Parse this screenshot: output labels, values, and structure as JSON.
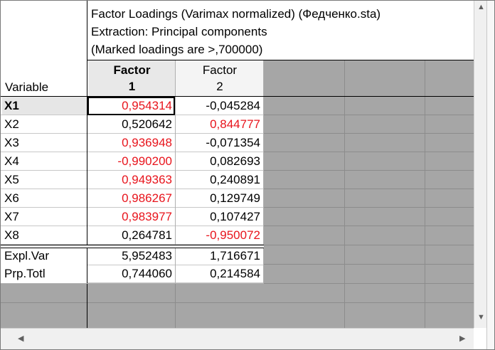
{
  "header": {
    "title_line1": "Factor Loadings (Varimax normalized) (Федченко.sta)",
    "title_line2": "Extraction: Principal components",
    "title_line3": "(Marked loadings are >,700000)",
    "variable_label": "Variable",
    "factor1_line1": "Factor",
    "factor1_line2": "1",
    "factor2_line1": "Factor",
    "factor2_line2": "2"
  },
  "rows": [
    {
      "label": "X1",
      "f1": "0,954314",
      "f2": "-0,045284",
      "f1_marked": true,
      "f2_marked": false
    },
    {
      "label": "X2",
      "f1": "0,520642",
      "f2": "0,844777",
      "f1_marked": false,
      "f2_marked": true
    },
    {
      "label": "X3",
      "f1": "0,936948",
      "f2": "-0,071354",
      "f1_marked": true,
      "f2_marked": false
    },
    {
      "label": "X4",
      "f1": "-0,990200",
      "f2": "0,082693",
      "f1_marked": true,
      "f2_marked": false
    },
    {
      "label": "X5",
      "f1": "0,949363",
      "f2": "0,240891",
      "f1_marked": true,
      "f2_marked": false
    },
    {
      "label": "X6",
      "f1": "0,986267",
      "f2": "0,129749",
      "f1_marked": true,
      "f2_marked": false
    },
    {
      "label": "X7",
      "f1": "0,983977",
      "f2": "0,107427",
      "f1_marked": true,
      "f2_marked": false
    },
    {
      "label": "X8",
      "f1": "0,264781",
      "f2": "-0,950072",
      "f1_marked": false,
      "f2_marked": true
    }
  ],
  "summary": [
    {
      "label": "Expl.Var",
      "f1": "5,952483",
      "f2": "1,716671"
    },
    {
      "label": "Prp.Totl",
      "f1": "0,744060",
      "f2": "0,214584"
    }
  ],
  "colors": {
    "marked": "#e8141c",
    "gray": "#a6a6a6"
  },
  "icons": {
    "up": "scroll-up-arrow-icon",
    "down": "scroll-down-arrow-icon",
    "left": "scroll-left-arrow-icon",
    "right": "scroll-right-arrow-icon"
  }
}
